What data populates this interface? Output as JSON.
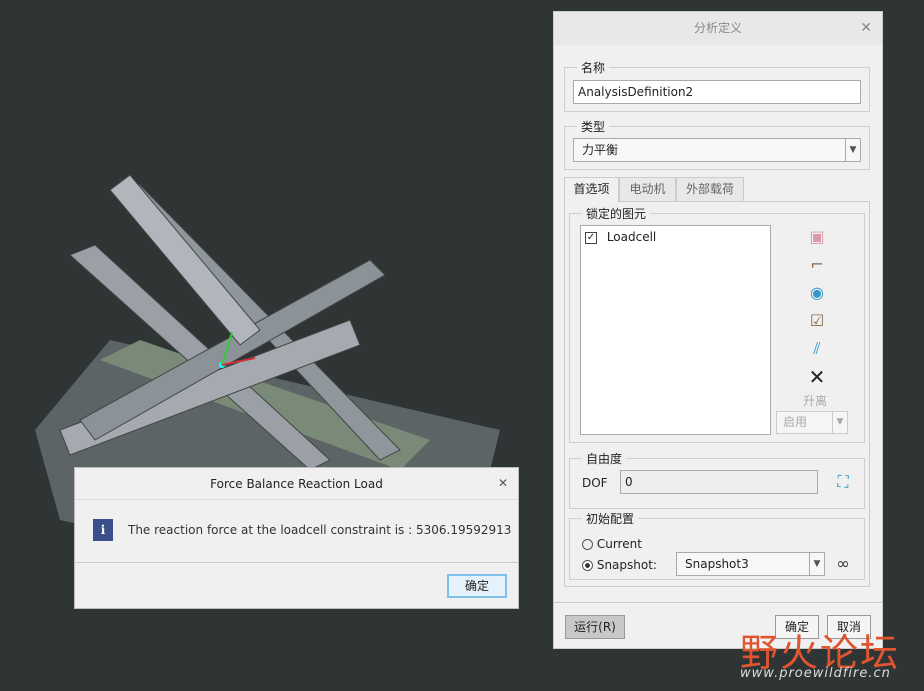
{
  "panel": {
    "title": "分析定义",
    "close": "✕",
    "name_group": "名称",
    "name_value": "AnalysisDefinition2",
    "type_group": "类型",
    "type_value": "力平衡",
    "tabs": [
      "首选项",
      "电动机",
      "外部载荷"
    ],
    "locked_group": "锁定的图元",
    "locked_items": [
      {
        "label": "Loadcell",
        "checked": true
      }
    ],
    "separate_label": "升离",
    "enable_value": "启用",
    "dof_group": "自由度",
    "dof_label": "DOF",
    "dof_value": "0",
    "init_group": "初始配置",
    "current_label": "Current",
    "snapshot_label": "Snapshot:",
    "snapshot_value": "Snapshot3",
    "run_button": "运行(R)",
    "ok_button": "确定",
    "cancel_button": "取消"
  },
  "message": {
    "title": "Force Balance Reaction Load",
    "close": "✕",
    "text": "The reaction force at the loadcell constraint is : 5306.19592913",
    "ok_button": "确定"
  },
  "watermark": {
    "cn": "野火论坛",
    "url": "www.proewildfire.cn"
  }
}
